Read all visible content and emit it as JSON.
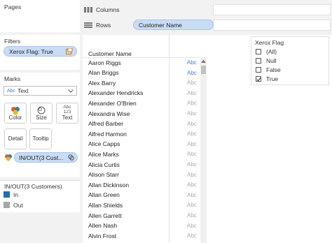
{
  "pages": {
    "title": "Pages"
  },
  "shelves": {
    "columns_label": "Columns",
    "rows_label": "Rows",
    "rows_pill": "Customer Name"
  },
  "filters": {
    "title": "Filters",
    "pill": "Xerox Flag: True"
  },
  "marks": {
    "title": "Marks",
    "mark_type": "Text",
    "mark_type_icon_text": "Abc",
    "buttons": {
      "color": "Color",
      "size": "Size",
      "text": "Text",
      "detail": "Detail",
      "tooltip": "Tooltip"
    },
    "text_icon_top": "Abc",
    "text_icon_bottom": "123",
    "set_pill": "IN/OUT(3 Cust..."
  },
  "legend": {
    "title": "IN/OUT(3 Customers)",
    "items": [
      {
        "label": "In",
        "color": "#1f6fa8"
      },
      {
        "label": "Out",
        "color": "#a6a6a6"
      }
    ]
  },
  "view": {
    "header": "Customer Name",
    "rows": [
      {
        "name": "Aaron Riggs",
        "mark": "Abc",
        "in": true
      },
      {
        "name": "Alan Briggs",
        "mark": "Abc",
        "in": true
      },
      {
        "name": "Alex Barry",
        "mark": "Abc",
        "in": false
      },
      {
        "name": "Alexander Hendricks",
        "mark": "Abc",
        "in": false
      },
      {
        "name": "Alexander O'Brien",
        "mark": "Abc",
        "in": false
      },
      {
        "name": "Alexandra Wise",
        "mark": "Abc",
        "in": false
      },
      {
        "name": "Alfred Barber",
        "mark": "Abc",
        "in": false
      },
      {
        "name": "Alfred Harmon",
        "mark": "Abc",
        "in": false
      },
      {
        "name": "Alice Capps",
        "mark": "Abc",
        "in": false
      },
      {
        "name": "Alice Marks",
        "mark": "Abc",
        "in": false
      },
      {
        "name": "Alicia Curtis",
        "mark": "Abc",
        "in": false
      },
      {
        "name": "Alison Starr",
        "mark": "Abc",
        "in": false
      },
      {
        "name": "Allan Dickinson",
        "mark": "Abc",
        "in": false
      },
      {
        "name": "Allan Green",
        "mark": "Abc",
        "in": false
      },
      {
        "name": "Allan Shields",
        "mark": "Abc",
        "in": false
      },
      {
        "name": "Allen Garrett",
        "mark": "Abc",
        "in": false
      },
      {
        "name": "Allen Nash",
        "mark": "Abc",
        "in": false
      },
      {
        "name": "Alvin Frost",
        "mark": "Abc",
        "in": false
      }
    ]
  },
  "xerox_filter": {
    "title": "Xerox Flag",
    "options": [
      {
        "label": "(All)",
        "checked": false
      },
      {
        "label": "Null",
        "checked": false
      },
      {
        "label": "False",
        "checked": false
      },
      {
        "label": "True",
        "checked": true
      }
    ]
  }
}
